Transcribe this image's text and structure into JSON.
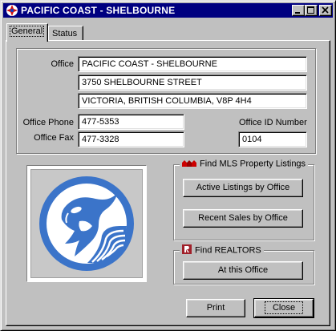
{
  "window": {
    "title": "PACIFIC COAST - SHELBOURNE",
    "titlebar_color": "#000080"
  },
  "tabs": [
    {
      "label": "General",
      "active": true
    },
    {
      "label": "Status",
      "active": false
    }
  ],
  "office": {
    "label": "Office",
    "name": "PACIFIC COAST - SHELBOURNE",
    "street": "3750 SHELBOURNE STREET",
    "city": "VICTORIA, BRITISH COLUMBIA, V8P 4H4",
    "phone_label": "Office Phone",
    "phone": "477-5353",
    "fax_label": "Office Fax",
    "fax": "477-3328",
    "id_label": "Office ID Number",
    "id": "0104"
  },
  "logo": {
    "icon": "orca-logo",
    "color": "#3b74c9"
  },
  "mls_group": {
    "title": "Find MLS Property Listings",
    "icon": "mls-houses-icon",
    "active_listings_button": "Active Listings by Office",
    "recent_sales_button": "Recent Sales by Office"
  },
  "realtors_group": {
    "title": "Find REALTORS",
    "icon": "realtor-r-icon",
    "at_office_button": "At this Office"
  },
  "footer": {
    "print_button": "Print",
    "close_button": "Close"
  },
  "accent_colors": {
    "mls_icon": "#cc0000",
    "realtor_icon": "#a0202a"
  }
}
